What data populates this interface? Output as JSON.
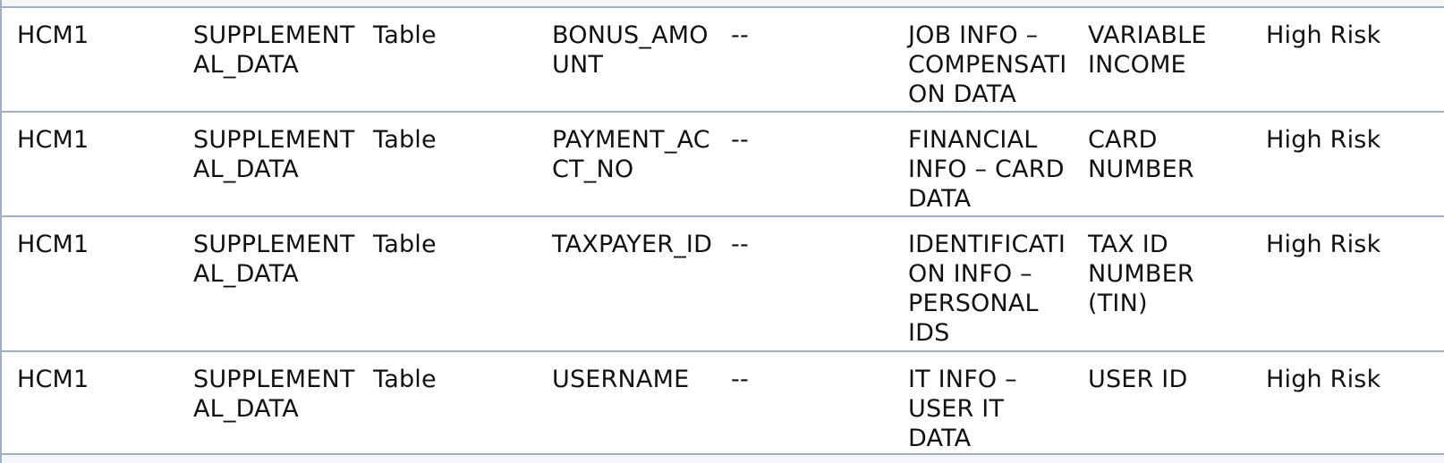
{
  "table": {
    "rows": [
      {
        "system": "HCM1",
        "object": "SUPPLEMENT\nAL_DATA",
        "object_type": "Table",
        "column": "BONUS_AMO\nUNT",
        "extra": "--",
        "category": "JOB INFO –\nCOMPENSATI\nON DATA",
        "subcategory": "VARIABLE\nINCOME",
        "risk": "High Risk"
      },
      {
        "system": "HCM1",
        "object": "SUPPLEMENT\nAL_DATA",
        "object_type": "Table",
        "column": "PAYMENT_AC\nCT_NO",
        "extra": "--",
        "category": "FINANCIAL\nINFO – CARD\nDATA",
        "subcategory": "CARD\nNUMBER",
        "risk": "High Risk"
      },
      {
        "system": "HCM1",
        "object": "SUPPLEMENT\nAL_DATA",
        "object_type": "Table",
        "column": "TAXPAYER_ID",
        "extra": "--",
        "category": "IDENTIFICATI\nON INFO –\nPERSONAL\nIDS",
        "subcategory": "TAX ID\nNUMBER\n(TIN)",
        "risk": "High Risk"
      },
      {
        "system": "HCM1",
        "object": "SUPPLEMENT\nAL_DATA",
        "object_type": "Table",
        "column": "USERNAME",
        "extra": "--",
        "category": "IT INFO –\nUSER IT\nDATA",
        "subcategory": "USER ID",
        "risk": "High Risk"
      }
    ]
  }
}
